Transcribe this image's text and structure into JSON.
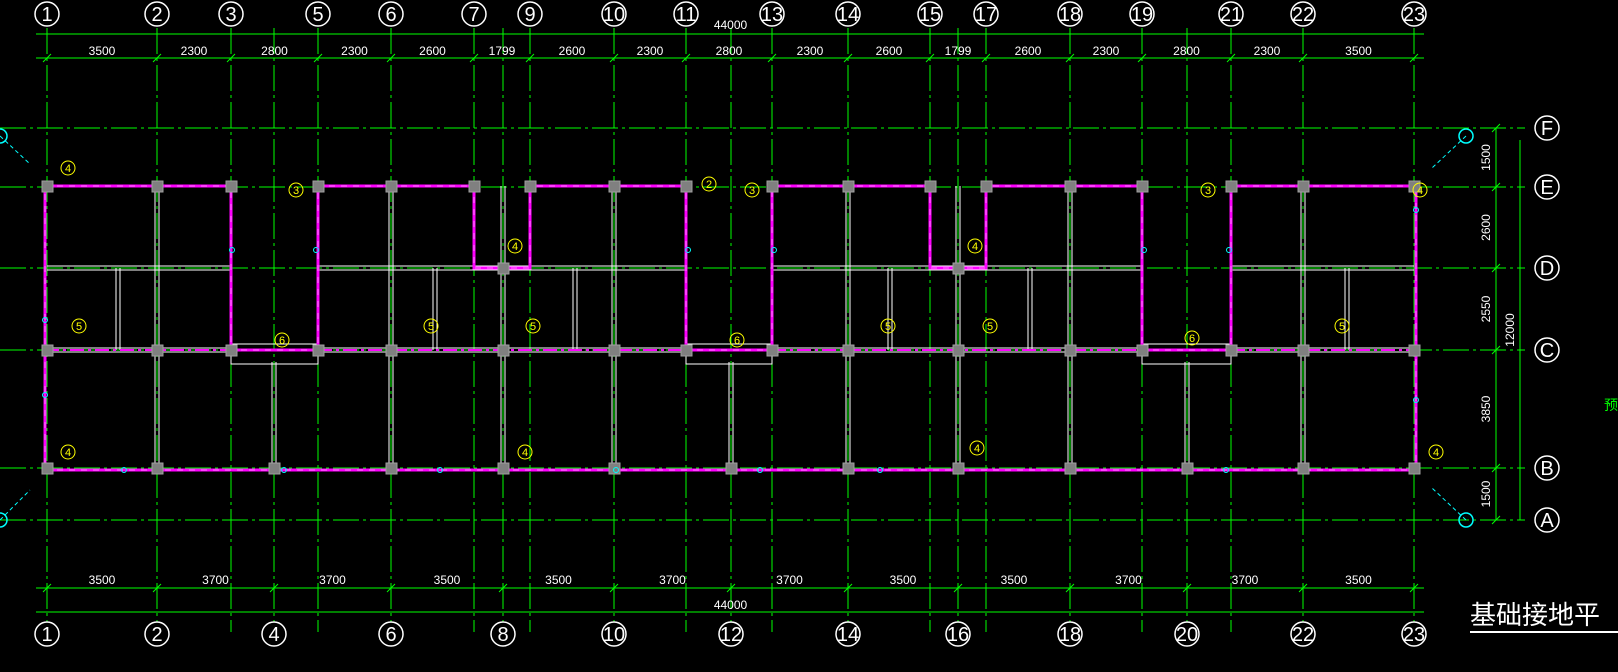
{
  "drawing": {
    "title": "基础接地平",
    "side_note": "预",
    "colors": {
      "background": "#000000",
      "grid": "#00ff00",
      "dimension": "#00ff00",
      "wall": "#ffffff",
      "ground_line": "#ff00ff",
      "column": "#808080",
      "tag": "#ffff00",
      "electrode": "#00ffff"
    }
  },
  "top_axes": [
    "1",
    "2",
    "3",
    "5",
    "6",
    "7",
    "9",
    "10",
    "11",
    "13",
    "14",
    "15",
    "17",
    "18",
    "19",
    "21",
    "22",
    "23"
  ],
  "top_total": "44000",
  "top_dims": [
    "3500",
    "2300",
    "2800",
    "2300",
    "2600",
    "1799",
    "2600",
    "2300",
    "2800",
    "2300",
    "2600",
    "1799",
    "2600",
    "2300",
    "2800",
    "2300",
    "3500"
  ],
  "bottom_axes": [
    "1",
    "2",
    "4",
    "6",
    "8",
    "10",
    "12",
    "14",
    "16",
    "18",
    "20",
    "22",
    "23"
  ],
  "bottom_total": "44000",
  "bottom_dims": [
    "3500",
    "3700",
    "3700",
    "3500",
    "3500",
    "3700",
    "3700",
    "3500",
    "3500",
    "3700",
    "3700",
    "3500"
  ],
  "right_axes": [
    "F",
    "E",
    "D",
    "C",
    "B",
    "A"
  ],
  "right_dims": [
    "1500",
    "2600",
    "2550",
    "3850",
    "1500"
  ],
  "right_total": "12000",
  "tags": [
    {
      "label": "4"
    },
    {
      "label": "3"
    },
    {
      "label": "4"
    },
    {
      "label": "2"
    },
    {
      "label": "3"
    },
    {
      "label": "4"
    },
    {
      "label": "3"
    },
    {
      "label": "4"
    },
    {
      "label": "5"
    },
    {
      "label": "6"
    },
    {
      "label": "5"
    },
    {
      "label": "5"
    },
    {
      "label": "6"
    },
    {
      "label": "5"
    },
    {
      "label": "5"
    },
    {
      "label": "6"
    },
    {
      "label": "5"
    },
    {
      "label": "4"
    },
    {
      "label": "4"
    },
    {
      "label": "4"
    },
    {
      "label": "4"
    }
  ]
}
